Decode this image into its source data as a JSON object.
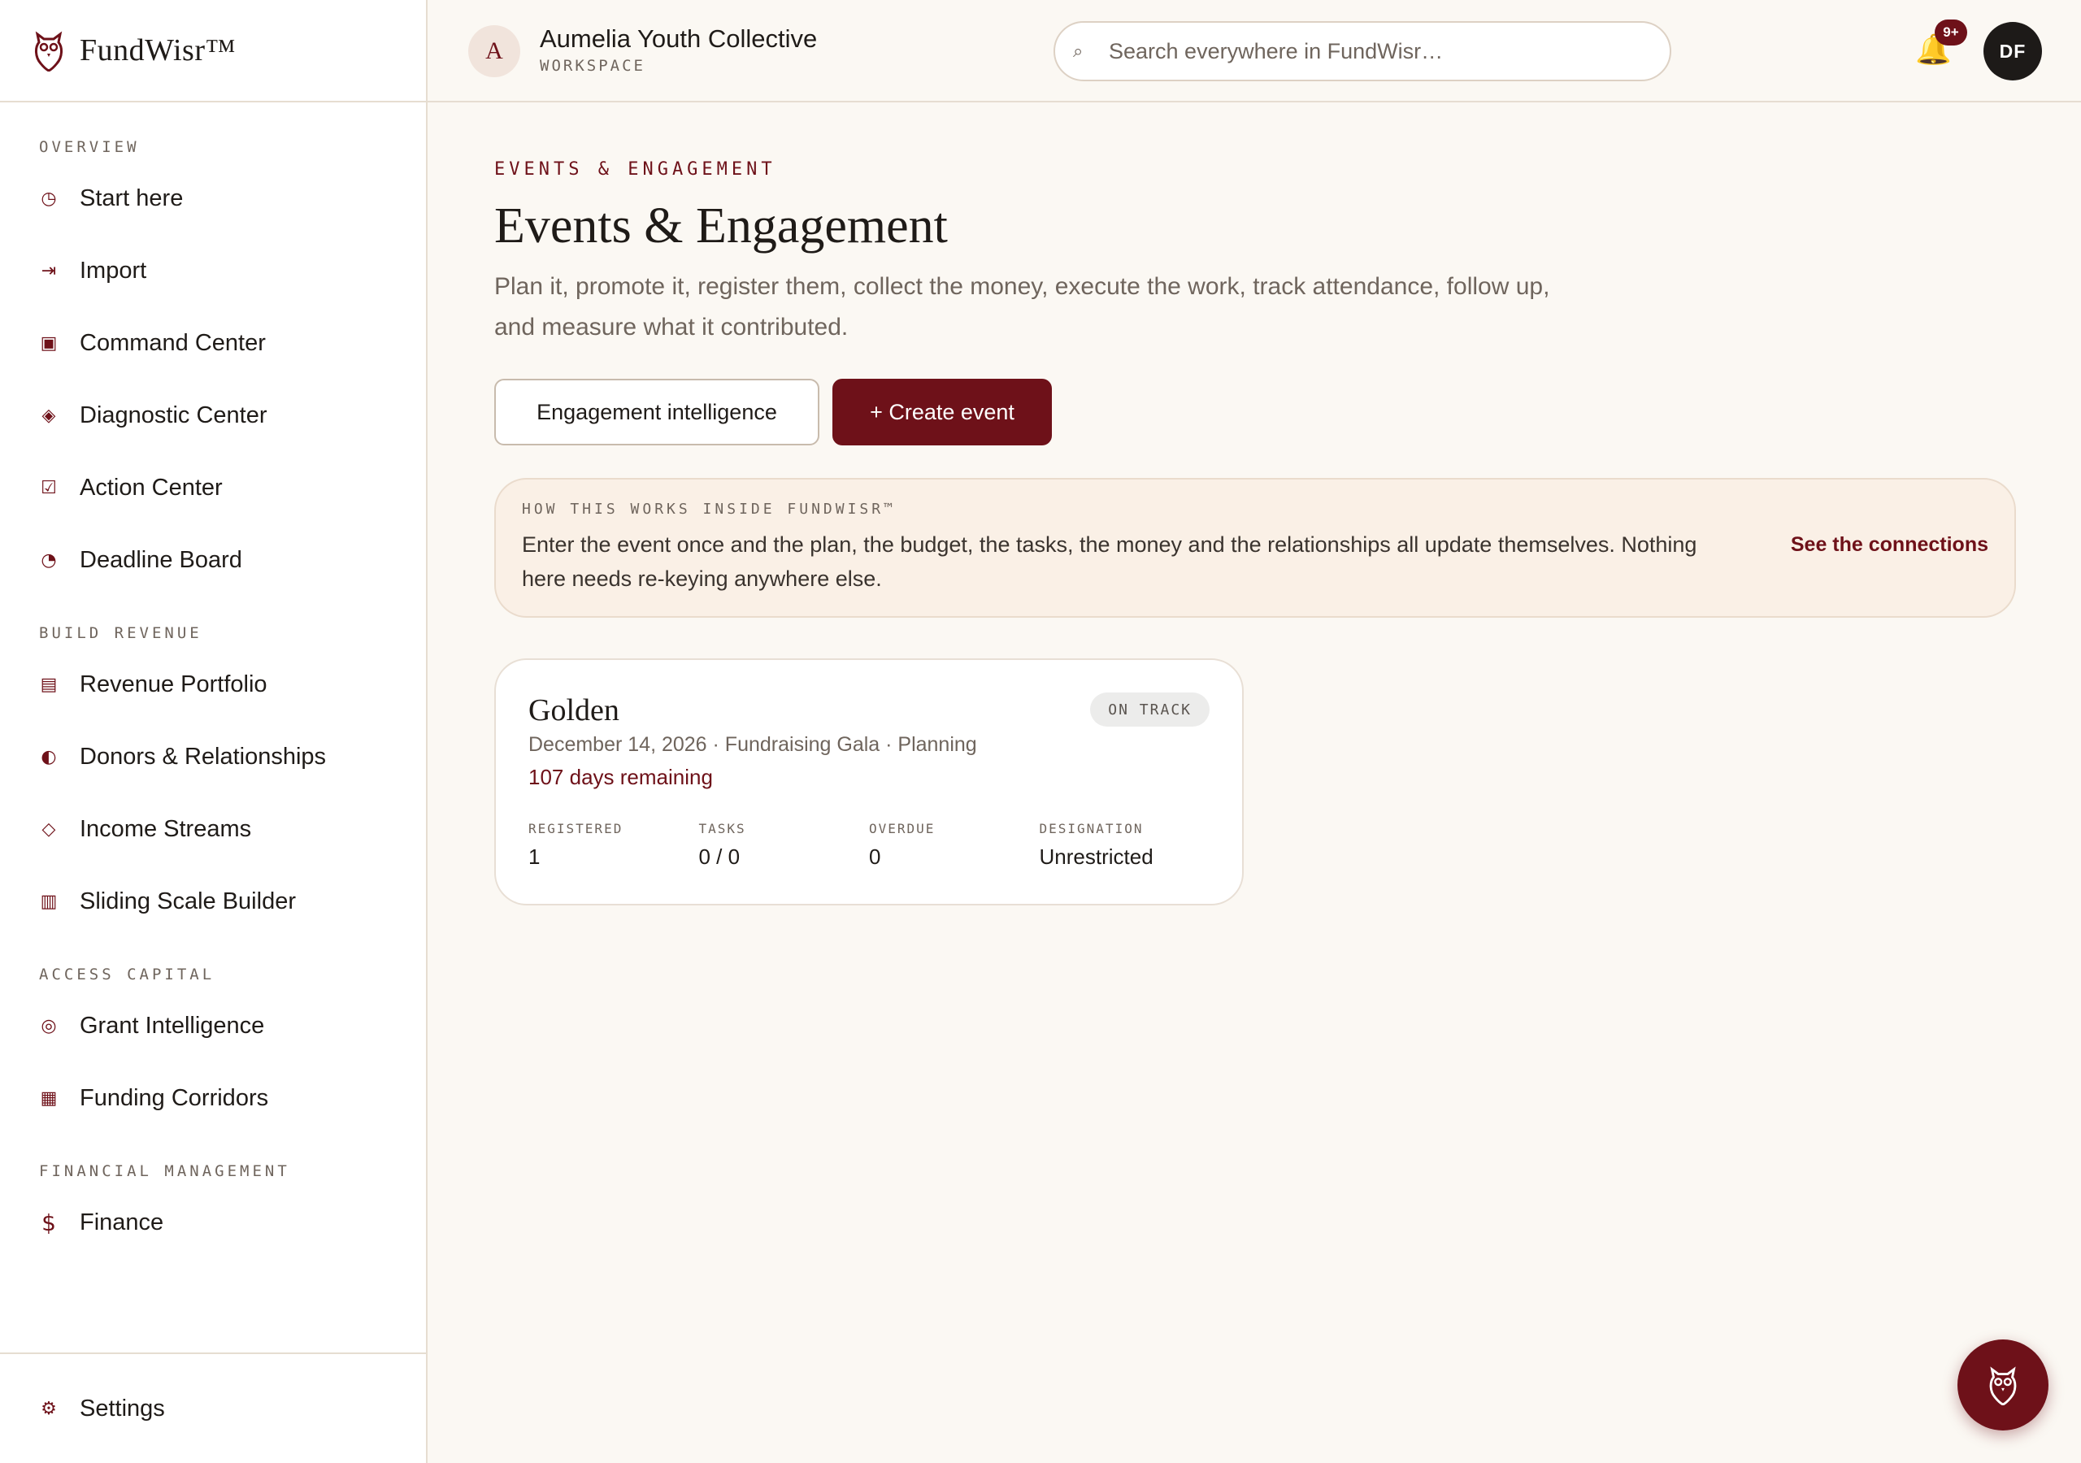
{
  "brand": {
    "name": "FundWisr™"
  },
  "workspace": {
    "initial": "A",
    "name": "Aumelia Youth Collective",
    "sub": "WORKSPACE"
  },
  "search": {
    "placeholder": "Search everywhere in FundWisr…",
    "value": ""
  },
  "notifications": {
    "badge": "9+"
  },
  "user": {
    "initials": "DF"
  },
  "sidebar": {
    "sections": [
      {
        "heading": "OVERVIEW",
        "items": [
          {
            "label": "Start here",
            "icon": "clock-icon",
            "glyph": "◷"
          },
          {
            "label": "Import",
            "icon": "import-arrow-icon",
            "glyph": "⇥"
          },
          {
            "label": "Command Center",
            "icon": "square-icon",
            "glyph": "▣"
          },
          {
            "label": "Diagnostic Center",
            "icon": "diamond-icon",
            "glyph": "◈"
          },
          {
            "label": "Action Center",
            "icon": "checkbox-icon",
            "glyph": "☑"
          },
          {
            "label": "Deadline Board",
            "icon": "pie-icon",
            "glyph": "◔"
          }
        ]
      },
      {
        "heading": "BUILD REVENUE",
        "items": [
          {
            "label": "Revenue Portfolio",
            "icon": "list-icon",
            "glyph": "▤"
          },
          {
            "label": "Donors & Relationships",
            "icon": "half-circle-icon",
            "glyph": "◐"
          },
          {
            "label": "Income Streams",
            "icon": "diamond-outline-icon",
            "glyph": "◇"
          },
          {
            "label": "Sliding Scale Builder",
            "icon": "columns-icon",
            "glyph": "▥"
          }
        ]
      },
      {
        "heading": "ACCESS CAPITAL",
        "items": [
          {
            "label": "Grant Intelligence",
            "icon": "target-icon",
            "glyph": "◎"
          },
          {
            "label": "Funding Corridors",
            "icon": "grid-icon",
            "glyph": "▦"
          }
        ]
      },
      {
        "heading": "FINANCIAL MANAGEMENT",
        "items": [
          {
            "label": "Finance",
            "icon": "dollar-icon",
            "glyph": "$"
          }
        ]
      }
    ],
    "settings": {
      "label": "Settings",
      "icon": "gear-icon",
      "glyph": "⚙"
    }
  },
  "page": {
    "eyebrow": "EVENTS & ENGAGEMENT",
    "title": "Events & Engagement",
    "description": "Plan it, promote it, register them, collect the money, execute the work, track attendance, follow up, and measure what it contributed.",
    "buttons": {
      "secondary": "Engagement intelligence",
      "primary": "+ Create event"
    }
  },
  "info": {
    "heading": "HOW THIS WORKS INSIDE FUNDWISR™",
    "text": "Enter the event once and the plan, the budget, the tasks, the money and the relationships all update themselves. Nothing here needs re-keying anywhere else.",
    "link": "See the connections"
  },
  "event": {
    "name": "Golden",
    "meta": "December 14, 2026 · Fundraising Gala · Planning",
    "remaining": "107 days remaining",
    "status": "ON TRACK",
    "stats": [
      {
        "label": "REGISTERED",
        "value": "1"
      },
      {
        "label": "TASKS",
        "value": "0 / 0"
      },
      {
        "label": "OVERDUE",
        "value": "0"
      },
      {
        "label": "DESIGNATION",
        "value": "Unrestricted"
      }
    ]
  },
  "colors": {
    "accent": "#6e1119",
    "background": "#fbf8f3",
    "bell": "#e39b2b"
  }
}
